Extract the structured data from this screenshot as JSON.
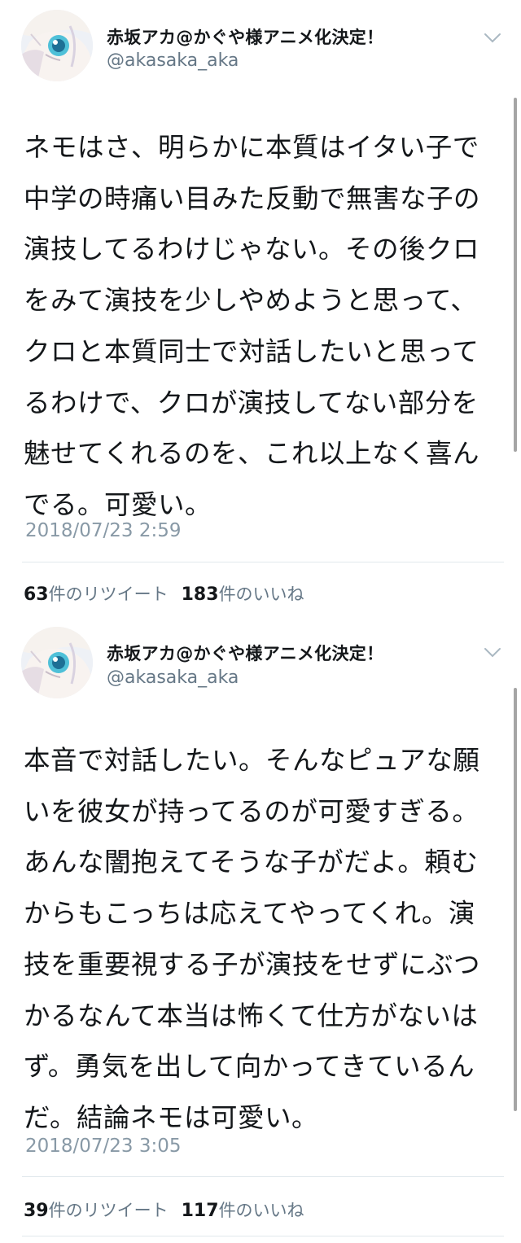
{
  "tweets": [
    {
      "display_name": "赤坂アカ@かぐや様アニメ化決定！",
      "handle": "@akasaka_aka",
      "text": "ネモはさ、明らかに本質はイタい子で中学の時痛い目みた反動で無害な子の演技してるわけじゃない。その後クロをみて演技を少しやめようと思って、クロと本質同士で対話したいと思ってるわけで、クロが演技してない部分を魅せてくれるのを、これ以上なく喜んでる。可愛い。",
      "timestamp": "2018/07/23 2:59",
      "retweets": "63",
      "retweets_label": "件のリツイート",
      "likes": "183",
      "likes_label": "件のいいね"
    },
    {
      "display_name": "赤坂アカ@かぐや様アニメ化決定！",
      "handle": "@akasaka_aka",
      "text": "本音で対話したい。そんなピュアな願いを彼女が持ってるのが可愛すぎる。あんな闇抱えてそうな子がだよ。頼むからもこっちは応えてやってくれ。演技を重要視する子が演技をせずにぶつかるなんて本当は怖くて仕方がないはず。勇気を出して向かってきているんだ。結論ネモは可愛い。",
      "timestamp": "2018/07/23 3:05",
      "retweets": "39",
      "retweets_label": "件のリツイート",
      "likes": "117",
      "likes_label": "件のいいね"
    }
  ],
  "icons": {
    "more": "chevron-down-icon",
    "avatar": "avatar"
  },
  "colors": {
    "text": "#14171a",
    "secondary": "#657786",
    "timestamp": "#8899a6",
    "divider": "#e1e8ed"
  }
}
